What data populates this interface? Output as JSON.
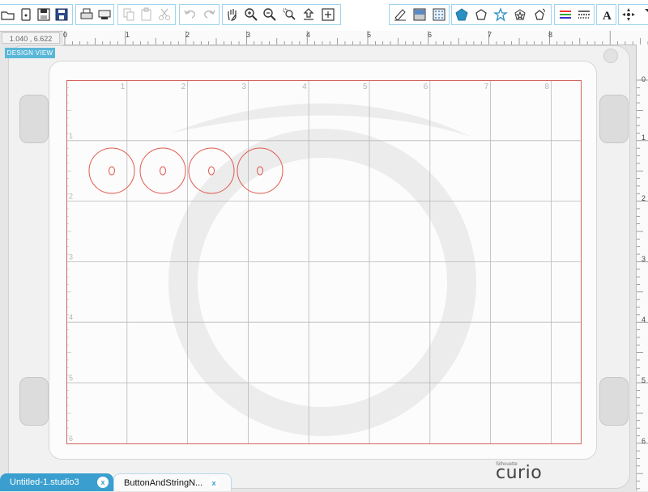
{
  "toolbar": {
    "groups": [
      {
        "name": "file",
        "icons": [
          "open-icon",
          "new-doc-icon",
          "save-icon",
          "save-as-icon"
        ]
      },
      {
        "name": "send",
        "icons": [
          "print-icon",
          "send-to-cutter-icon"
        ]
      },
      {
        "name": "clipboard",
        "icons": [
          "copy-icon",
          "paste-icon",
          "cut-icon"
        ]
      },
      {
        "name": "undo",
        "icons": [
          "undo-icon",
          "redo-icon"
        ]
      },
      {
        "name": "view",
        "icons": [
          "pan-icon",
          "zoom-in-icon",
          "zoom-out-icon",
          "zoom-select-icon",
          "zoom-fit-page-icon",
          "zoom-fit-icon"
        ]
      },
      {
        "name": "panels",
        "icons": [
          "line-tool-icon",
          "fill-color-icon",
          "fill-pattern-icon"
        ]
      },
      {
        "name": "shapes",
        "icons": [
          "pentagon-icon",
          "polygon-icon",
          "star-icon",
          "offset-star-icon",
          "rotate-shape-icon"
        ]
      },
      {
        "name": "line",
        "icons": [
          "line-color-icon",
          "line-style-icon"
        ]
      },
      {
        "name": "text",
        "icons": [
          "text-icon"
        ]
      },
      {
        "name": "transform",
        "icons": [
          "transform-icon",
          "more-icon"
        ]
      }
    ]
  },
  "coordinates": "1.040 , 6.622",
  "view_label": "DESIGN VIEW",
  "ruler": {
    "top_numbers": [
      "0",
      "1",
      "2",
      "3",
      "4",
      "5",
      "6",
      "7",
      "8"
    ],
    "side_numbers": [
      "0",
      "1",
      "2",
      "3",
      "4",
      "5",
      "6"
    ],
    "grid_col_numbers": [
      "1",
      "2",
      "3",
      "4",
      "5",
      "6",
      "7",
      "8"
    ],
    "grid_row_numbers": [
      "1",
      "2",
      "3",
      "4",
      "5",
      "6"
    ]
  },
  "brand": {
    "small": "Silhouette",
    "name": "curio"
  },
  "tabs": [
    {
      "label": "Untitled-1.studio3",
      "active": true,
      "close": "x"
    },
    {
      "label": "ButtonAndStringN...",
      "active": false,
      "close": "x"
    }
  ],
  "shapes": [
    {
      "type": "button",
      "holes": 1
    },
    {
      "type": "button",
      "holes": 1
    },
    {
      "type": "button",
      "holes": 1
    },
    {
      "type": "button",
      "holes": 1
    }
  ],
  "colors": {
    "accent": "#3a9fcf",
    "cutline": "#e05a4f",
    "grid": "#b8b8b8"
  }
}
